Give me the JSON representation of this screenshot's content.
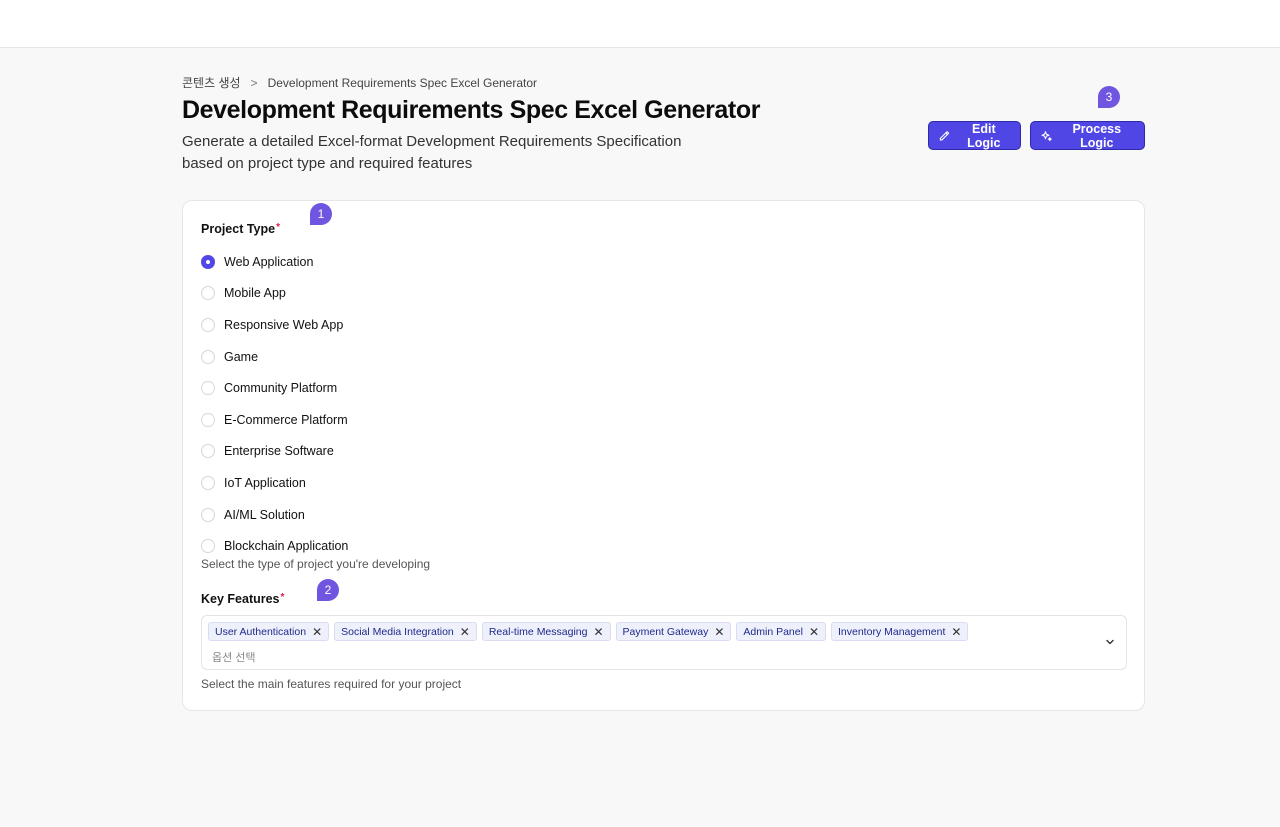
{
  "breadcrumb": {
    "parent": "콘텐츠 생성",
    "separator": ">",
    "current": "Development Requirements Spec Excel Generator"
  },
  "header": {
    "title": "Development Requirements Spec Excel Generator",
    "description": "Generate a detailed Excel-format Development Requirements Specification based on project type and required features"
  },
  "actions": {
    "edit_label": "Edit Logic",
    "process_label": "Process Logic"
  },
  "markers": {
    "m1": "1",
    "m2": "2",
    "m3": "3"
  },
  "project_type": {
    "label": "Project Type",
    "required_mark": "*",
    "options": [
      "Web Application",
      "Mobile App",
      "Responsive Web App",
      "Game",
      "Community Platform",
      "E-Commerce Platform",
      "Enterprise Software",
      "IoT Application",
      "AI/ML Solution",
      "Blockchain Application"
    ],
    "selected": "Web Application",
    "help": "Select the type of project you're developing"
  },
  "key_features": {
    "label": "Key Features",
    "required_mark": "*",
    "tags": [
      "User Authentication",
      "Social Media Integration",
      "Real-time Messaging",
      "Payment Gateway",
      "Admin Panel",
      "Inventory Management"
    ],
    "remove_glyph": "✕",
    "placeholder": "옵션 선택",
    "help": "Select the main features required for your project"
  },
  "colors": {
    "accent": "#4f46e5",
    "marker": "#6f55e0",
    "required": "#e11d48",
    "tag_bg": "#eef0fb"
  },
  "icons": {
    "edit": "pencil-icon",
    "process": "sparkles-icon",
    "dropdown": "chevron-down-icon",
    "breadcrumb_sep": "chevron-right-icon"
  }
}
